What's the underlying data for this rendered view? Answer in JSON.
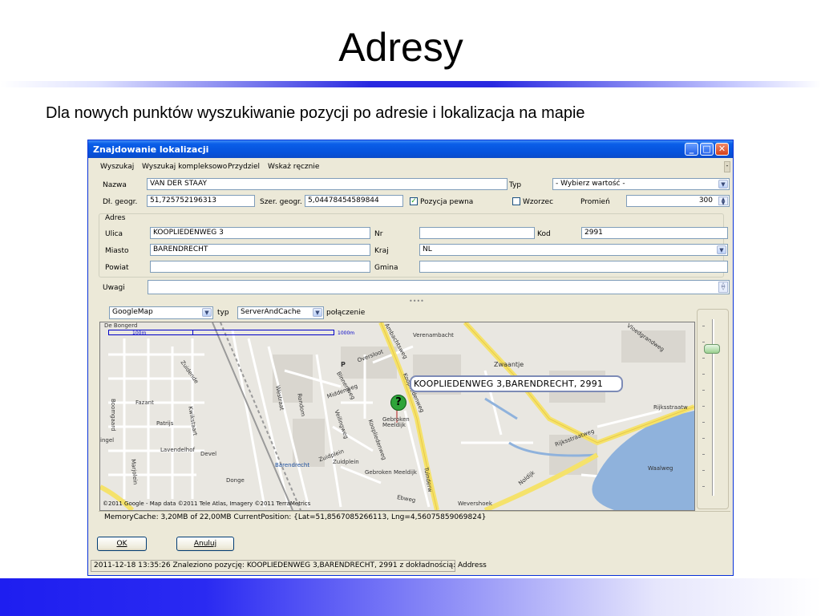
{
  "slide": {
    "title": "Adresy",
    "subtitle": "Dla nowych punktów wyszukiwanie pozycji po adresie i lokalizacja na mapie"
  },
  "window": {
    "title": "Znajdowanie lokalizacji",
    "menu": [
      "Wyszukaj",
      "Wyszukaj kompleksowo",
      "Przydziel",
      "Wskaż ręcznie"
    ]
  },
  "form": {
    "nazwa_label": "Nazwa",
    "nazwa_value": "VAN DER STAAY",
    "typ_label": "Typ",
    "typ_value": "- Wybierz wartość -",
    "dl_label": "Dł. geogr.",
    "dl_value": "51,725752196313",
    "szer_label": "Szer. geogr.",
    "szer_value": "5,04478454589844",
    "pozycja_label": "Pozycja pewna",
    "pozycja_checked": true,
    "wzorzec_label": "Wzorzec",
    "wzorzec_checked": false,
    "promien_label": "Promień",
    "promien_value": "300",
    "adres_group": "Adres",
    "ulica_label": "Ulica",
    "ulica_value": "KOOPLIEDENWEG 3",
    "nr_label": "Nr",
    "nr_value": "",
    "kod_label": "Kod",
    "kod_value": "2991",
    "miasto_label": "Miasto",
    "miasto_value": "BARENDRECHT",
    "kraj_label": "Kraj",
    "kraj_value": "NL",
    "powiat_label": "Powiat",
    "powiat_value": "",
    "gmina_label": "Gmina",
    "gmina_value": "",
    "uwagi_label": "Uwagi",
    "uwagi_value": ""
  },
  "map_toolbar": {
    "provider_value": "GoogleMap",
    "typ_label": "typ",
    "mode_value": "ServerAndCache",
    "connection_label": "połączenie"
  },
  "map": {
    "scale_1": "100m",
    "scale_2": "1000m",
    "address_label": "KOOPLIEDENWEG 3,BARENDRECHT, 2991",
    "pin_glyph": "?",
    "copyright": "©2011 Google - Map data ©2011 Tele Atlas, Imagery ©2011 TerraMetrics",
    "labels": {
      "de_bongerd": "De Bongerd",
      "verenambacht": "Verenambacht",
      "zwaantje": "Zwaantje",
      "oversloot": "Oversloot",
      "binnenweg": "Binnenweg",
      "middenweg": "Middenweg",
      "westerstraat": "Westraat",
      "rondom": "Rondom",
      "ambachtsweg": "Ambachtsweg",
      "kooplied": "Koopliedenweg",
      "gebroken": "Gebroken Meeldijk",
      "gebroken2": "Gebroken Meeldijk",
      "barendrecht": "Barendrecht",
      "zuidplein": "Zuidplein",
      "zuidplein2": "Zuidplein",
      "patrijs": "Patrijs",
      "fazant": "Fazant",
      "boomgaard": "Boomgaard",
      "lavendelhof": "Lavendelhof",
      "devel": "Devel",
      "donge": "Donge",
      "rijksstraatweg": "Rijksstraatweg",
      "rijksstraatweg2": "Rijksstraatw",
      "noldijk": "Noldijk",
      "waalweg": "Waalweg",
      "weversshoek": "Wevershoek",
      "ebweg": "Ebweg",
      "tuinderweg": "Tuinderw",
      "vloedgrandweg": "Vloedgrandweg",
      "zuidende": "Zuidende",
      "kwikstaart": "Kwikstaart",
      "ingel": "ingel",
      "marjolein": "Marjolein",
      "vlietweg": "Veilingweg",
      "p": "P"
    }
  },
  "status": {
    "memory": "MemoryCache: 3,20MB of 22,00MB  CurrentPosition: {Lat=51,8567085266113, Lng=4,56075859069824}",
    "ok": "OK",
    "cancel": "Anuluj",
    "bottom": "2011-12-18 13:35:26 Znaleziono pozycję: KOOPLIEDENWEG 3,BARENDRECHT, 2991 z dokładnością: Address"
  },
  "colors": {
    "accent": "#0a5ee8",
    "road_major": "#f5e26b",
    "water": "#8fb2dc"
  }
}
